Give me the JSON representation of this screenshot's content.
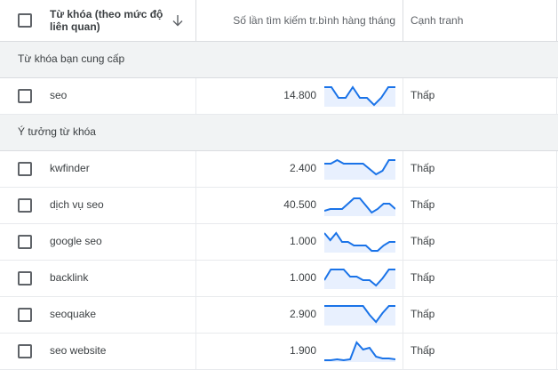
{
  "header": {
    "keyword_col": "Từ khóa (theo mức độ liên quan)",
    "volume_col": "Số lần tìm kiếm tr.bình hàng tháng",
    "competition_col": "Cạnh tranh"
  },
  "groups": [
    {
      "label": "Từ khóa bạn cung cấp",
      "rows": [
        {
          "keyword": "seo",
          "volume": "14.800",
          "competition": "Thấp",
          "trend": [
            10,
            10,
            4,
            4,
            10,
            4,
            4,
            0,
            4,
            10,
            10
          ]
        }
      ]
    },
    {
      "label": "Ý tưởng từ khóa",
      "rows": [
        {
          "keyword": "kwfinder",
          "volume": "2.400",
          "competition": "Thấp",
          "trend": [
            8,
            8,
            10,
            8,
            8,
            8,
            8,
            5,
            2,
            4,
            10,
            10
          ]
        },
        {
          "keyword": "dịch vụ seo",
          "volume": "40.500",
          "competition": "Thấp",
          "trend": [
            2,
            3,
            3,
            3,
            6,
            9,
            9,
            5,
            1,
            3,
            6,
            6,
            3
          ]
        },
        {
          "keyword": "google seo",
          "volume": "1.000",
          "competition": "Thấp",
          "trend": [
            10,
            6,
            10,
            5,
            5,
            3,
            3,
            3,
            0,
            0,
            3,
            5,
            5
          ]
        },
        {
          "keyword": "backlink",
          "volume": "1.000",
          "competition": "Thấp",
          "trend": [
            4,
            10,
            10,
            10,
            6,
            6,
            4,
            4,
            1,
            5,
            10,
            10
          ]
        },
        {
          "keyword": "seoquake",
          "volume": "2.900",
          "competition": "Thấp",
          "trend": [
            10,
            10,
            10,
            10,
            10,
            10,
            10,
            5,
            1,
            6,
            10,
            10
          ]
        },
        {
          "keyword": "seo website",
          "volume": "1.900",
          "competition": "Thấp",
          "trend": [
            0,
            0,
            0.5,
            0,
            0.5,
            10,
            6,
            7,
            2,
            1,
            1,
            0.5
          ]
        }
      ]
    }
  ],
  "colors": {
    "trend_line": "#1a73e8",
    "trend_fill": "#e8f0fe"
  },
  "icons": {
    "sort": "arrow-down-icon",
    "checkbox": "checkbox-unchecked-icon"
  }
}
